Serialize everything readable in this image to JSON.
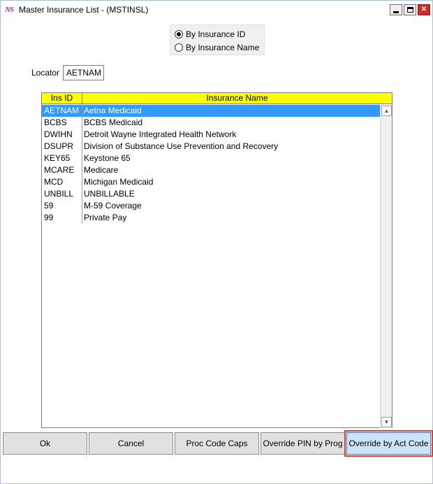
{
  "window": {
    "icon_text": "NS",
    "title": "Master Insurance List - (MSTINSL)",
    "controls": {
      "minimize": "minimize",
      "maximize": "maximize",
      "close": "✕"
    }
  },
  "sort_options": [
    {
      "label": "By Insurance ID",
      "checked": true
    },
    {
      "label": "By Insurance Name",
      "checked": false
    }
  ],
  "locator": {
    "label": "Locator",
    "value": "AETNAM"
  },
  "table": {
    "columns": [
      "Ins ID",
      "Insurance Name"
    ],
    "rows": [
      {
        "id": "AETNAM",
        "name": "Aetna Medicaid",
        "selected": true
      },
      {
        "id": "BCBS",
        "name": "BCBS Medicaid"
      },
      {
        "id": "DWIHN",
        "name": "Detroit Wayne Integrated Health Network"
      },
      {
        "id": "DSUPR",
        "name": "Division of Substance Use Prevention and Recovery"
      },
      {
        "id": "KEY65",
        "name": "Keystone 65"
      },
      {
        "id": "MCARE",
        "name": "Medicare"
      },
      {
        "id": "MCD",
        "name": "Michigan Medicaid"
      },
      {
        "id": "UNBILL",
        "name": "UNBILLABLE"
      },
      {
        "id": "59",
        "name": "M-59 Coverage"
      },
      {
        "id": "99",
        "name": "Private Pay"
      }
    ],
    "header_color": "#ffff00",
    "selected_color": "#3399ff"
  },
  "buttons": {
    "ok": "Ok",
    "cancel": "Cancel",
    "proc_code_caps": "Proc Code Caps",
    "override_pin": "Override PIN by Prog",
    "override_act": "Override by Act Code"
  },
  "highlight_color": "#e03c3c"
}
